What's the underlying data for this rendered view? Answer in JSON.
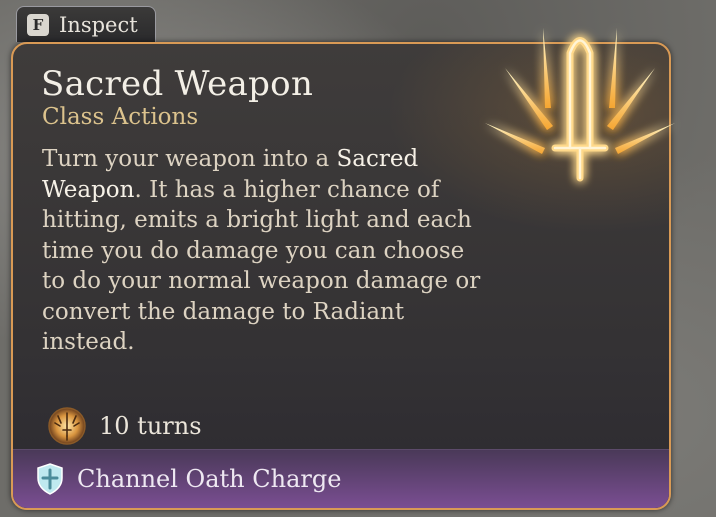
{
  "inspect": {
    "key": "F",
    "label": "Inspect"
  },
  "tooltip": {
    "title": "Sacred Weapon",
    "category": "Class Actions",
    "description": {
      "part1": "Turn your weapon into a ",
      "highlight": "Sacred Weapon",
      "part2": ". It has a higher chance of hitting, emits a bright light and each time you do damage you can choose to do your normal weapon damage or convert the damage to Radiant instead."
    },
    "duration": "10 turns",
    "cost": "Channel Oath Charge",
    "icon": "sacred-weapon-sword-icon"
  },
  "colors": {
    "border": "#d99a55",
    "subtitle": "#dcc38d",
    "footer": "#7a4e92",
    "glow": "#ffb040"
  }
}
